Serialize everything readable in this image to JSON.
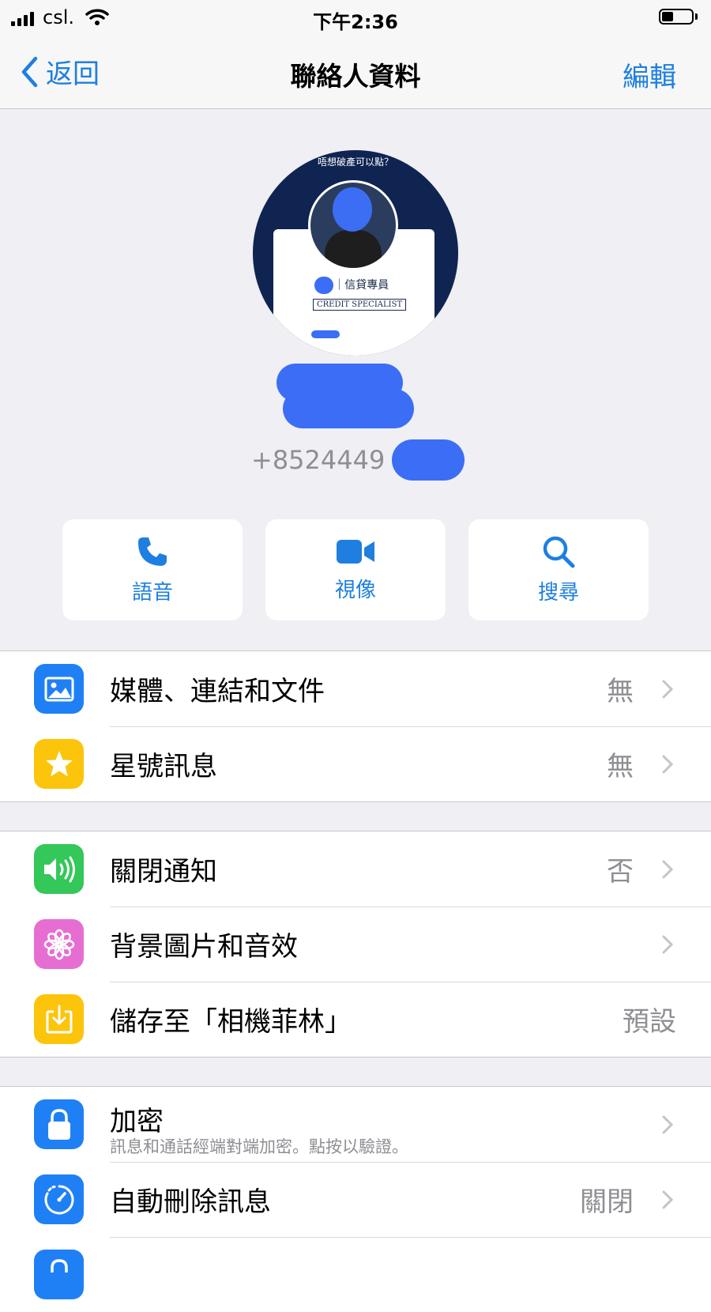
{
  "status_bar": {
    "carrier": "csl.",
    "time": "下午2:36",
    "battery_level": 0.4
  },
  "nav": {
    "back_label": "返回",
    "title": "聯絡人資料",
    "edit_label": "編輯"
  },
  "profile": {
    "avatar_top_text": "唔想破產可以點？",
    "avatar_name": "陳 ｜信貸專員",
    "avatar_badge": "CREDIT SPECIALIST",
    "phone": "+8524449"
  },
  "actions": [
    {
      "label": "語音",
      "icon": "phone-icon"
    },
    {
      "label": "視像",
      "icon": "video-camera-icon"
    },
    {
      "label": "搜尋",
      "icon": "search-icon"
    }
  ],
  "groups": [
    {
      "rows": [
        {
          "label": "媒體、連結和文件",
          "value": "無",
          "icon": "photo-icon",
          "color": "#1f80f5",
          "chevron": true
        },
        {
          "label": "星號訊息",
          "value": "無",
          "icon": "star-icon",
          "color": "#fcc40b",
          "chevron": true
        }
      ]
    },
    {
      "rows": [
        {
          "label": "關閉通知",
          "value": "否",
          "icon": "speaker-icon",
          "color": "#34c759",
          "chevron": true
        },
        {
          "label": "背景圖片和音效",
          "value": "",
          "icon": "flower-icon",
          "color": "#e66ed2",
          "chevron": true
        },
        {
          "label": "儲存至「相機菲林」",
          "value": "預設",
          "icon": "download-icon",
          "color": "#fcc40b",
          "chevron": false
        }
      ]
    },
    {
      "rows": [
        {
          "label": "加密",
          "sub": "訊息和通話經端對端加密。點按以驗證。",
          "value": "",
          "icon": "lock-icon",
          "color": "#1f80f5",
          "chevron": true
        },
        {
          "label": "自動刪除訊息",
          "value": "關閉",
          "icon": "timer-icon",
          "color": "#1f80f5",
          "chevron": true
        },
        {
          "label": "",
          "value": "",
          "icon": "privacy-icon",
          "color": "#1f80f5",
          "chevron": false
        }
      ]
    }
  ]
}
